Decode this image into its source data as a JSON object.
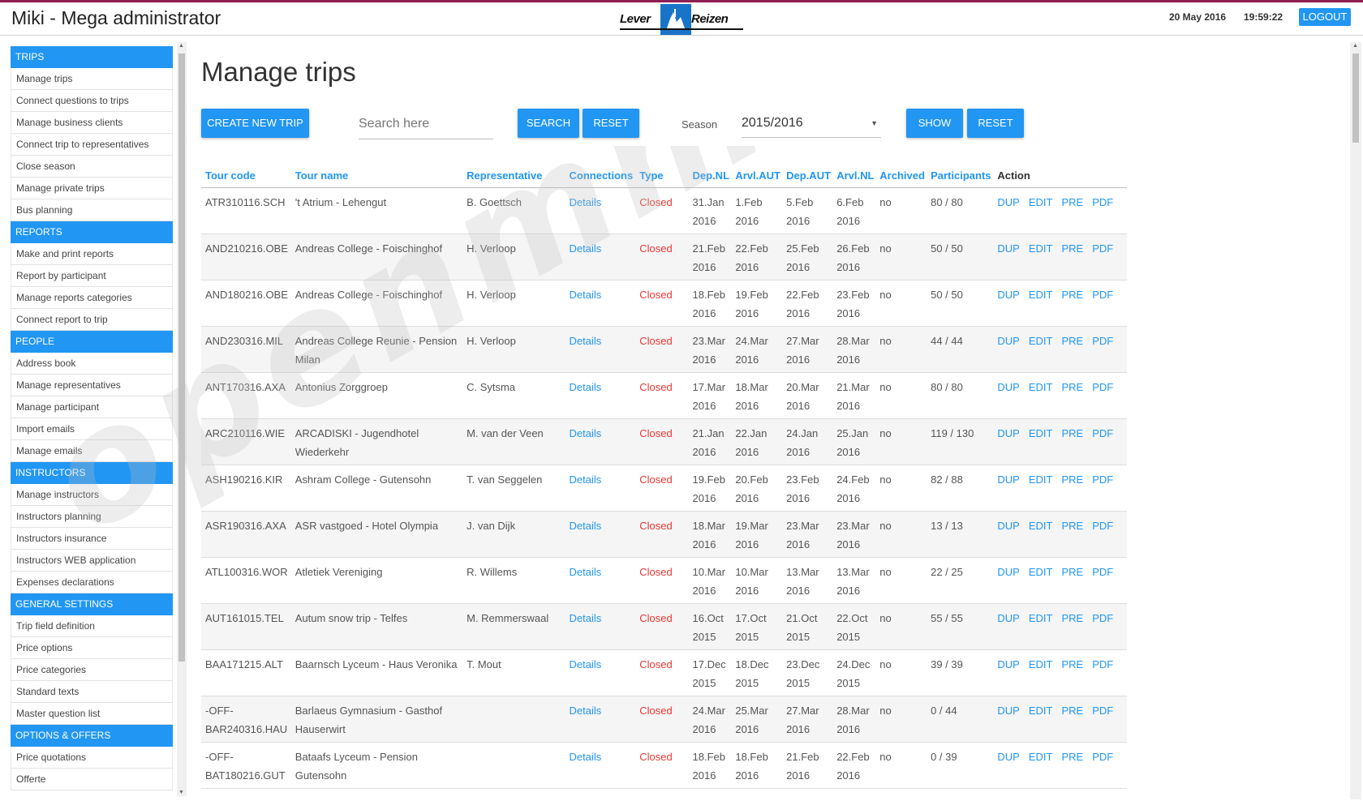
{
  "header": {
    "app_title": "Miki - Mega administrator",
    "logo_left": "Lever",
    "logo_right": "Reizen",
    "date": "20 May 2016",
    "time": "19:59:22",
    "logout_label": "LOGOUT"
  },
  "sidebar": {
    "sections": [
      {
        "title": "TRIPS",
        "items": [
          "Manage trips",
          "Connect questions to trips",
          "Manage business clients",
          "Connect trip to representatives",
          "Close season",
          "Manage private trips",
          "Bus planning"
        ]
      },
      {
        "title": "REPORTS",
        "items": [
          "Make and print reports",
          "Report by participant",
          "Manage reports categories",
          "Connect report to trip"
        ]
      },
      {
        "title": "PEOPLE",
        "items": [
          "Address book",
          "Manage representatives",
          "Manage participant",
          "Import emails",
          "Manage emails"
        ]
      },
      {
        "title": "INSTRUCTORS",
        "items": [
          "Manage instructors",
          "Instructors planning",
          "Instructors insurance",
          "Instructors WEB application",
          "Expenses declarations"
        ]
      },
      {
        "title": "GENERAL SETTINGS",
        "items": [
          "Trip field definition",
          "Price options",
          "Price categories",
          "Standard texts",
          "Master question list"
        ]
      },
      {
        "title": "OPTIONS & OFFERS",
        "items": [
          "Price quotations",
          "Offerte"
        ]
      }
    ]
  },
  "main": {
    "title": "Manage trips",
    "create_label": "CREATE NEW TRIP",
    "search_placeholder": "Search here",
    "search_label": "SEARCH",
    "reset_label": "RESET",
    "season_label": "Season",
    "season_value": "2015/2016",
    "show_label": "SHOW",
    "reset2_label": "RESET"
  },
  "table": {
    "headers": [
      "Tour code",
      "Tour name",
      "Representative",
      "Connections",
      "Type",
      "Dep.NL",
      "Arvl.AUT",
      "Dep.AUT",
      "Arvl.NL",
      "Archived",
      "Participants",
      "Action"
    ],
    "actions": [
      "DUP",
      "EDIT",
      "PRE",
      "PDF"
    ],
    "rows": [
      {
        "code": "ATR310116.SCH",
        "name": "'t Atrium - Lehengut",
        "rep": "B. Goettsch",
        "conn": "Details",
        "type": "Closed",
        "dep_nl": "31.Jan 2016",
        "arr_aut": "1.Feb 2016",
        "dep_aut": "5.Feb 2016",
        "arr_nl": "6.Feb 2016",
        "archived": "no",
        "participants": "80 / 80"
      },
      {
        "code": "AND210216.OBE",
        "name": "Andreas College - Foischinghof",
        "rep": "H. Verloop",
        "conn": "Details",
        "type": "Closed",
        "dep_nl": "21.Feb 2016",
        "arr_aut": "22.Feb 2016",
        "dep_aut": "25.Feb 2016",
        "arr_nl": "26.Feb 2016",
        "archived": "no",
        "participants": "50 / 50"
      },
      {
        "code": "AND180216.OBE",
        "name": "Andreas College - Foischinghof",
        "rep": "H. Verloop",
        "conn": "Details",
        "type": "Closed",
        "dep_nl": "18.Feb 2016",
        "arr_aut": "19.Feb 2016",
        "dep_aut": "22.Feb 2016",
        "arr_nl": "23.Feb 2016",
        "archived": "no",
        "participants": "50 / 50"
      },
      {
        "code": "AND230316.MIL",
        "name": "Andreas College Reunie - Pension Milan",
        "rep": "H. Verloop",
        "conn": "Details",
        "type": "Closed",
        "dep_nl": "23.Mar 2016",
        "arr_aut": "24.Mar 2016",
        "dep_aut": "27.Mar 2016",
        "arr_nl": "28.Mar 2016",
        "archived": "no",
        "participants": "44 / 44"
      },
      {
        "code": "ANT170316.AXA",
        "name": "Antonius Zorggroep",
        "rep": "C. Sytsma",
        "conn": "Details",
        "type": "Closed",
        "dep_nl": "17.Mar 2016",
        "arr_aut": "18.Mar 2016",
        "dep_aut": "20.Mar 2016",
        "arr_nl": "21.Mar 2016",
        "archived": "no",
        "participants": "80 / 80"
      },
      {
        "code": "ARC210116.WIE",
        "name": "ARCADISKI - Jugendhotel Wiederkehr",
        "rep": "M. van der Veen",
        "conn": "Details",
        "type": "Closed",
        "dep_nl": "21.Jan 2016",
        "arr_aut": "22.Jan 2016",
        "dep_aut": "24.Jan 2016",
        "arr_nl": "25.Jan 2016",
        "archived": "no",
        "participants": "119 / 130"
      },
      {
        "code": "ASH190216.KIR",
        "name": "Ashram College - Gutensohn",
        "rep": "T. van Seggelen",
        "conn": "Details",
        "type": "Closed",
        "dep_nl": "19.Feb 2016",
        "arr_aut": "20.Feb 2016",
        "dep_aut": "23.Feb 2016",
        "arr_nl": "24.Feb 2016",
        "archived": "no",
        "participants": "82 / 88"
      },
      {
        "code": "ASR190316.AXA",
        "name": "ASR vastgoed - Hotel Olympia",
        "rep": "J. van Dijk",
        "conn": "Details",
        "type": "Closed",
        "dep_nl": "18.Mar 2016",
        "arr_aut": "19.Mar 2016",
        "dep_aut": "23.Mar 2016",
        "arr_nl": "23.Mar 2016",
        "archived": "no",
        "participants": "13 / 13"
      },
      {
        "code": "ATL100316.WOR",
        "name": "Atletiek Vereniging",
        "rep": "R. Willems",
        "conn": "Details",
        "type": "Closed",
        "dep_nl": "10.Mar 2016",
        "arr_aut": "10.Mar 2016",
        "dep_aut": "13.Mar 2016",
        "arr_nl": "13.Mar 2016",
        "archived": "no",
        "participants": "22 / 25"
      },
      {
        "code": "AUT161015.TEL",
        "name": "Autum snow trip - Telfes",
        "rep": "M. Remmerswaal",
        "conn": "Details",
        "type": "Closed",
        "dep_nl": "16.Oct 2015",
        "arr_aut": "17.Oct 2015",
        "dep_aut": "21.Oct 2015",
        "arr_nl": "22.Oct 2015",
        "archived": "no",
        "participants": "55 / 55"
      },
      {
        "code": "BAA171215.ALT",
        "name": "Baarnsch Lyceum - Haus Veronika",
        "rep": "T. Mout",
        "conn": "Details",
        "type": "Closed",
        "dep_nl": "17.Dec 2015",
        "arr_aut": "18.Dec 2015",
        "dep_aut": "23.Dec 2015",
        "arr_nl": "24.Dec 2015",
        "archived": "no",
        "participants": "39 / 39"
      },
      {
        "code": "-OFF-BAR240316.HAU",
        "name": "Barlaeus Gymnasium - Gasthof Hauserwirt",
        "rep": "",
        "conn": "Details",
        "type": "Closed",
        "dep_nl": "24.Mar 2016",
        "arr_aut": "25.Mar 2016",
        "dep_aut": "27.Mar 2016",
        "arr_nl": "28.Mar 2016",
        "archived": "no",
        "participants": "0 / 44"
      },
      {
        "code": "-OFF-BAT180216.GUT",
        "name": "Bataafs Lyceum - Pension Gutensohn",
        "rep": "",
        "conn": "Details",
        "type": "Closed",
        "dep_nl": "18.Feb 2016",
        "arr_aut": "18.Feb 2016",
        "dep_aut": "21.Feb 2016",
        "arr_nl": "22.Feb 2016",
        "archived": "no",
        "participants": "0 / 39"
      }
    ]
  },
  "watermark": "openmmetrix",
  "colors": {
    "accent": "#2196f3",
    "closed": "#e53935",
    "brand_stripe": "#8e1f52"
  }
}
